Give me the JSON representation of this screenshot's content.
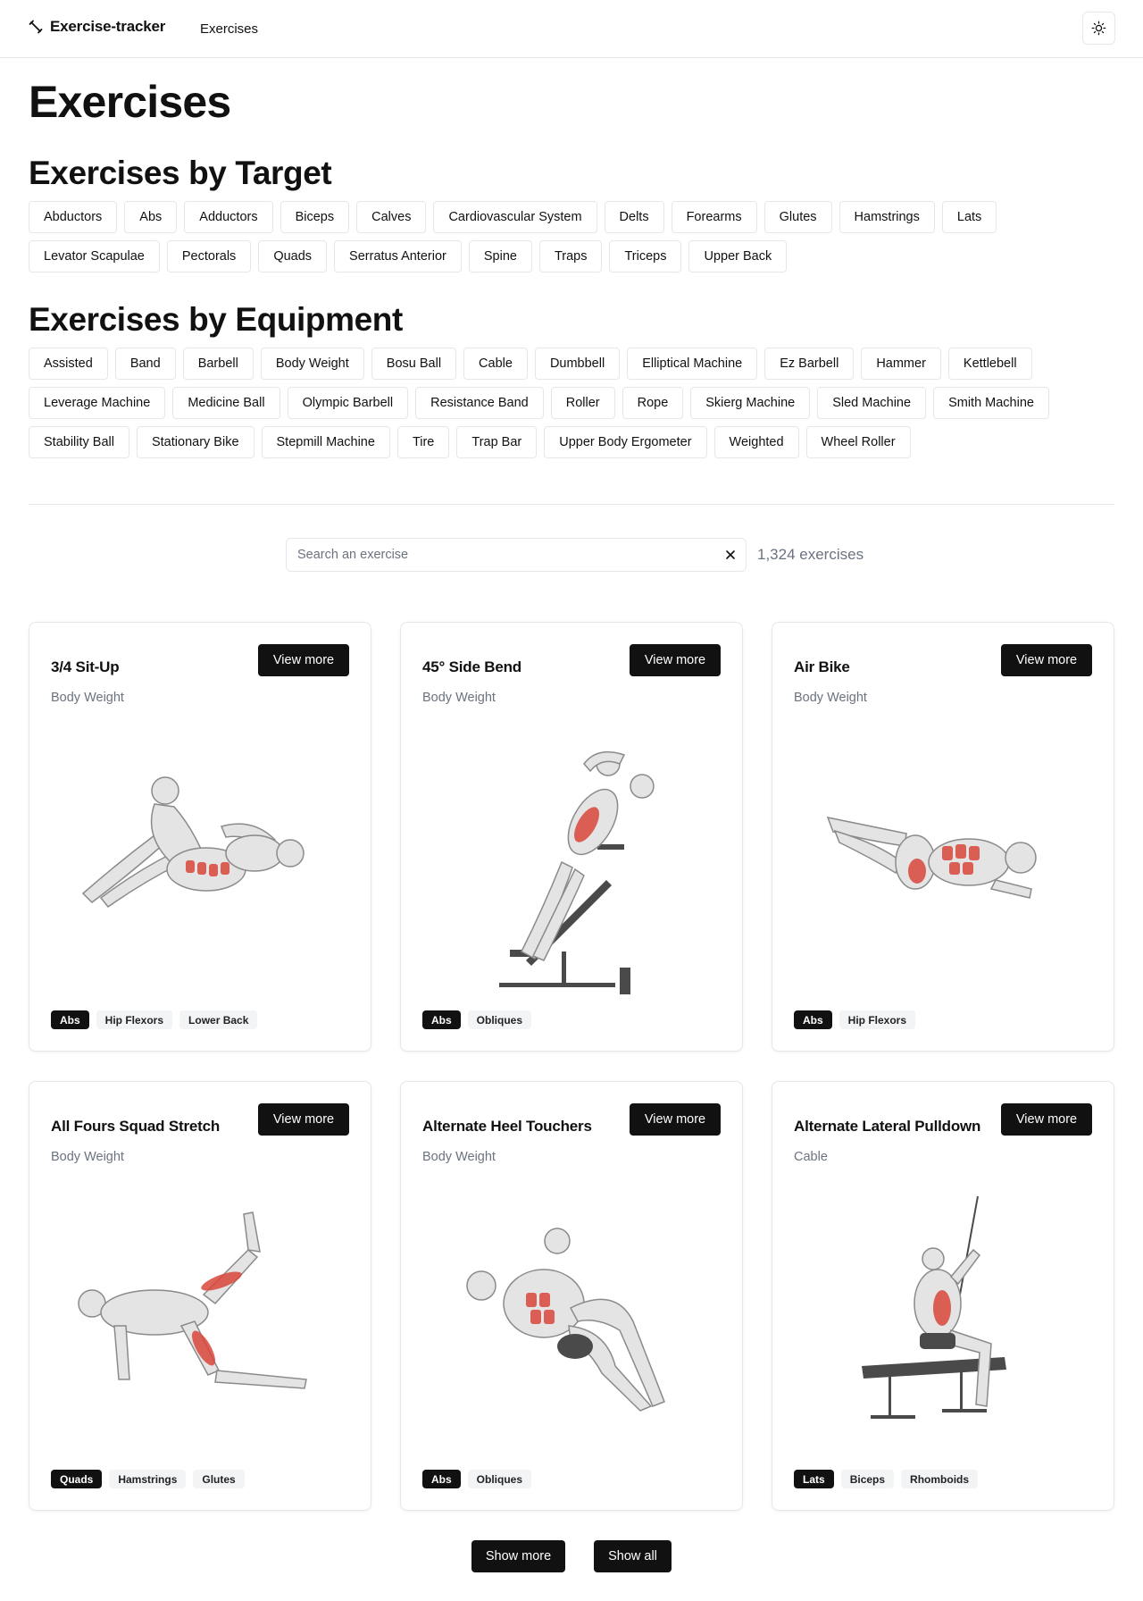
{
  "header": {
    "brand": "Exercise-tracker",
    "nav_link": "Exercises"
  },
  "page_title": "Exercises",
  "target_section": {
    "title": "Exercises by Target",
    "chips": [
      "Abductors",
      "Abs",
      "Adductors",
      "Biceps",
      "Calves",
      "Cardiovascular System",
      "Delts",
      "Forearms",
      "Glutes",
      "Hamstrings",
      "Lats",
      "Levator Scapulae",
      "Pectorals",
      "Quads",
      "Serratus Anterior",
      "Spine",
      "Traps",
      "Triceps",
      "Upper Back"
    ]
  },
  "equipment_section": {
    "title": "Exercises by Equipment",
    "chips": [
      "Assisted",
      "Band",
      "Barbell",
      "Body Weight",
      "Bosu Ball",
      "Cable",
      "Dumbbell",
      "Elliptical Machine",
      "Ez Barbell",
      "Hammer",
      "Kettlebell",
      "Leverage Machine",
      "Medicine Ball",
      "Olympic Barbell",
      "Resistance Band",
      "Roller",
      "Rope",
      "Skierg Machine",
      "Sled Machine",
      "Smith Machine",
      "Stability Ball",
      "Stationary Bike",
      "Stepmill Machine",
      "Tire",
      "Trap Bar",
      "Upper Body Ergometer",
      "Weighted",
      "Wheel Roller"
    ]
  },
  "search": {
    "placeholder": "Search an exercise",
    "value": "",
    "count": "1,324 exercises"
  },
  "cards": [
    {
      "title": "3/4 Sit-Up",
      "equipment": "Body Weight",
      "button": "View more",
      "tags": [
        "Abs",
        "Hip Flexors",
        "Lower Back"
      ]
    },
    {
      "title": "45° Side Bend",
      "equipment": "Body Weight",
      "button": "View more",
      "tags": [
        "Abs",
        "Obliques"
      ]
    },
    {
      "title": "Air Bike",
      "equipment": "Body Weight",
      "button": "View more",
      "tags": [
        "Abs",
        "Hip Flexors"
      ]
    },
    {
      "title": "All Fours Squad Stretch",
      "equipment": "Body Weight",
      "button": "View more",
      "tags": [
        "Quads",
        "Hamstrings",
        "Glutes"
      ]
    },
    {
      "title": "Alternate Heel Touchers",
      "equipment": "Body Weight",
      "button": "View more",
      "tags": [
        "Abs",
        "Obliques"
      ]
    },
    {
      "title": "Alternate Lateral Pulldown",
      "equipment": "Cable",
      "button": "View more",
      "tags": [
        "Lats",
        "Biceps",
        "Rhomboids"
      ]
    }
  ],
  "buttons": {
    "show_more": "Show more",
    "show_all": "Show all"
  },
  "colors": {
    "primary": "#111111",
    "muscle_highlight": "#d9473a",
    "border": "#e5e7eb"
  }
}
